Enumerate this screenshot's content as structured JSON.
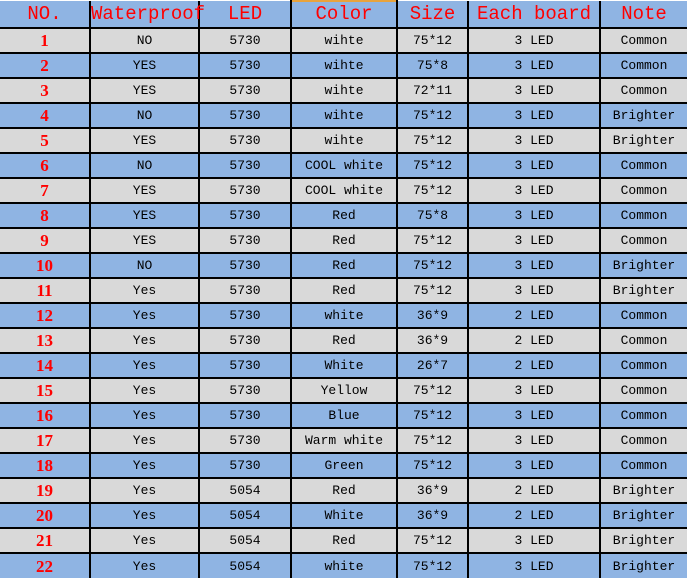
{
  "table": {
    "columns": [
      {
        "key": "no",
        "label": "NO."
      },
      {
        "key": "wp",
        "label": "Waterproof"
      },
      {
        "key": "led",
        "label": "LED"
      },
      {
        "key": "color",
        "label": "Color"
      },
      {
        "key": "size",
        "label": "Size"
      },
      {
        "key": "board",
        "label": "Each board"
      },
      {
        "key": "note",
        "label": "Note"
      }
    ],
    "colors": {
      "header_background": "#8FB4E3",
      "header_text": "#FF0000",
      "row_odd_background": "#D9D9D9",
      "row_even_background": "#8FB4E3",
      "cell_text": "#000000",
      "no_column_text": "#FF0000",
      "grid_line": "#000000",
      "color_header_top_accent": "#E8A33D"
    },
    "rows": [
      {
        "no": "1",
        "wp": "NO",
        "led": "5730",
        "color": "wihte",
        "size": "75*12",
        "board": "3 LED",
        "note": "Common"
      },
      {
        "no": "2",
        "wp": "YES",
        "led": "5730",
        "color": "wihte",
        "size": "75*8",
        "board": "3 LED",
        "note": "Common"
      },
      {
        "no": "3",
        "wp": "YES",
        "led": "5730",
        "color": "wihte",
        "size": "72*11",
        "board": "3 LED",
        "note": "Common"
      },
      {
        "no": "4",
        "wp": "NO",
        "led": "5730",
        "color": "wihte",
        "size": "75*12",
        "board": "3 LED",
        "note": "Brighter"
      },
      {
        "no": "5",
        "wp": "YES",
        "led": "5730",
        "color": "wihte",
        "size": "75*12",
        "board": "3 LED",
        "note": "Brighter"
      },
      {
        "no": "6",
        "wp": "NO",
        "led": "5730",
        "color": "COOL white",
        "size": "75*12",
        "board": "3 LED",
        "note": "Common"
      },
      {
        "no": "7",
        "wp": "YES",
        "led": "5730",
        "color": "COOL white",
        "size": "75*12",
        "board": "3 LED",
        "note": "Common"
      },
      {
        "no": "8",
        "wp": "YES",
        "led": "5730",
        "color": "Red",
        "size": "75*8",
        "board": "3 LED",
        "note": "Common"
      },
      {
        "no": "9",
        "wp": "YES",
        "led": "5730",
        "color": "Red",
        "size": "75*12",
        "board": "3 LED",
        "note": "Common"
      },
      {
        "no": "10",
        "wp": "NO",
        "led": "5730",
        "color": "Red",
        "size": "75*12",
        "board": "3 LED",
        "note": "Brighter"
      },
      {
        "no": "11",
        "wp": "Yes",
        "led": "5730",
        "color": "Red",
        "size": "75*12",
        "board": "3 LED",
        "note": "Brighter"
      },
      {
        "no": "12",
        "wp": "Yes",
        "led": "5730",
        "color": "white",
        "size": "36*9",
        "board": "2 LED",
        "note": "Common"
      },
      {
        "no": "13",
        "wp": "Yes",
        "led": "5730",
        "color": "Red",
        "size": "36*9",
        "board": "2 LED",
        "note": "Common"
      },
      {
        "no": "14",
        "wp": "Yes",
        "led": "5730",
        "color": "White",
        "size": "26*7",
        "board": "2 LED",
        "note": "Common"
      },
      {
        "no": "15",
        "wp": "Yes",
        "led": "5730",
        "color": "Yellow",
        "size": "75*12",
        "board": "3 LED",
        "note": "Common"
      },
      {
        "no": "16",
        "wp": "Yes",
        "led": "5730",
        "color": "Blue",
        "size": "75*12",
        "board": "3 LED",
        "note": "Common"
      },
      {
        "no": "17",
        "wp": "Yes",
        "led": "5730",
        "color": "Warm white",
        "size": "75*12",
        "board": "3 LED",
        "note": "Common"
      },
      {
        "no": "18",
        "wp": "Yes",
        "led": "5730",
        "color": "Green",
        "size": "75*12",
        "board": "3 LED",
        "note": "Common"
      },
      {
        "no": "19",
        "wp": "Yes",
        "led": "5054",
        "color": "Red",
        "size": "36*9",
        "board": "2 LED",
        "note": "Brighter"
      },
      {
        "no": "20",
        "wp": "Yes",
        "led": "5054",
        "color": "White",
        "size": "36*9",
        "board": "2 LED",
        "note": "Brighter"
      },
      {
        "no": "21",
        "wp": "Yes",
        "led": "5054",
        "color": "Red",
        "size": "75*12",
        "board": "3 LED",
        "note": "Brighter"
      },
      {
        "no": "22",
        "wp": "Yes",
        "led": "5054",
        "color": "white",
        "size": "75*12",
        "board": "3 LED",
        "note": "Brighter"
      }
    ]
  }
}
